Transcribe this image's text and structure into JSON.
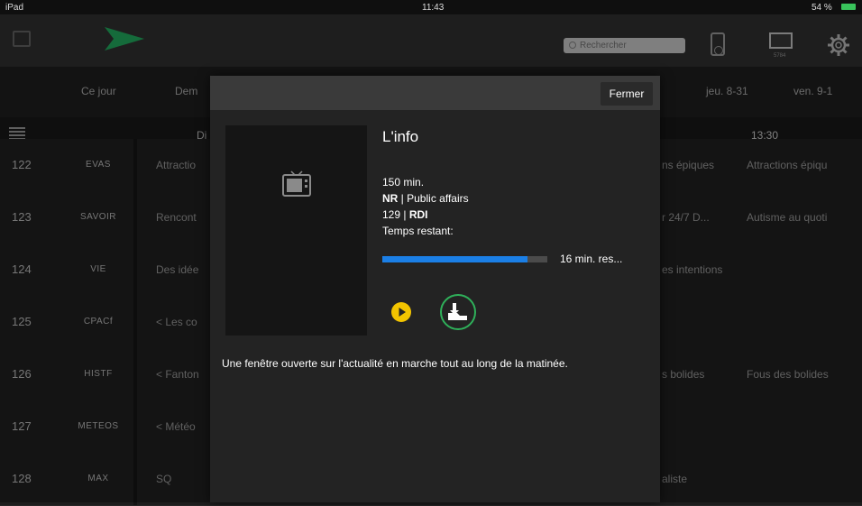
{
  "status_bar": {
    "left": "iPad",
    "time": "11:43",
    "battery": "54 %"
  },
  "top_bar": {
    "search_placeholder": "Rechercher",
    "icons": [
      "lock-icon",
      "logo-arrow-icon",
      "remote-icon",
      "tv-icon",
      "gear-icon"
    ],
    "tv_sub_label": "5784"
  },
  "date_tabs": [
    "Ce jour",
    "Dem",
    "jeu. 8-31",
    "ven. 9-1"
  ],
  "time_header": {
    "col1": "Di",
    "col_right": "13:30"
  },
  "channels": [
    {
      "num": "122",
      "name": "EVAS",
      "prog1": "Attractio",
      "prog2": "ns épiques",
      "prog3": "Attractions épiqu"
    },
    {
      "num": "123",
      "name": "SAVOIR",
      "prog1": "Rencont",
      "prog2": "r 24/7   D...",
      "prog3": "Autisme au quoti"
    },
    {
      "num": "124",
      "name": "VIE",
      "prog1": "Des idée",
      "prog2": "es intentions",
      "prog3": ""
    },
    {
      "num": "125",
      "name": "CPACf",
      "prog1": "< Les co",
      "prog2": "",
      "prog3": ""
    },
    {
      "num": "126",
      "name": "HISTF",
      "prog1": "< Fanton",
      "prog2": "s bolides",
      "prog3": "Fous des bolides"
    },
    {
      "num": "127",
      "name": "METEOS",
      "prog1": "< Météo",
      "prog2": "",
      "prog3": ""
    },
    {
      "num": "128",
      "name": "MAX",
      "prog1": "SQ",
      "prog2": "aliste",
      "prog3": ""
    }
  ],
  "modal": {
    "close_label": "Fermer",
    "title": "L'info",
    "duration": "150 min.",
    "rating": "NR",
    "genre": " | Public affairs",
    "channel_num": "129 | ",
    "channel_name": "RDI",
    "time_left_label": "Temps restant:",
    "progress": 0.88,
    "remaining_text": "16 min. res...",
    "description": "Une fenêtre ouverte sur l'actualité en marche tout au long de la matinée.",
    "colors": {
      "progress": "#1b7fe6",
      "play": "#f2c400",
      "highlight_ring": "#2fb05a"
    }
  }
}
